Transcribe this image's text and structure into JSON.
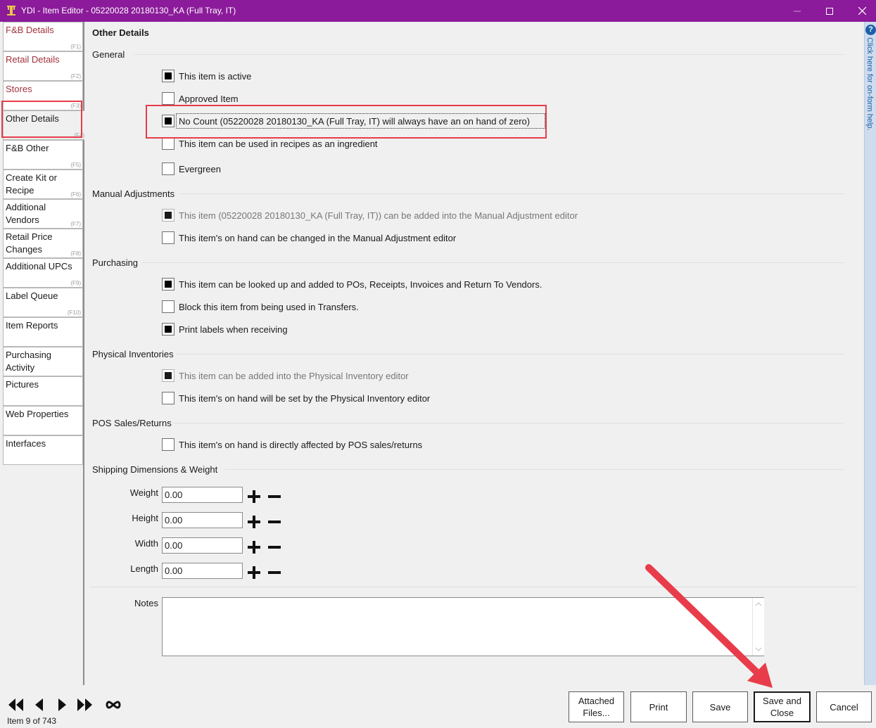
{
  "window": {
    "title": "YDI - Item Editor - 05220028 20180130_KA (Full Tray, IT)"
  },
  "nav": {
    "items": [
      {
        "label": "F&B Details",
        "key": "(F1)"
      },
      {
        "label": "Retail Details",
        "key": "(F2)"
      },
      {
        "label": "Stores",
        "key": "(F3)"
      },
      {
        "label": "Other Details",
        "key": "(F4)"
      },
      {
        "label": "F&B Other",
        "key": "(F5)"
      },
      {
        "label": "Create Kit or Recipe",
        "key": "(F6)"
      },
      {
        "label": "Additional Vendors",
        "key": "(F7)"
      },
      {
        "label": "Retail Price Changes",
        "key": "(F8)"
      },
      {
        "label": "Additional UPCs",
        "key": "(F9)"
      },
      {
        "label": "Label Queue",
        "key": "(F10)"
      },
      {
        "label": "Item Reports",
        "key": ""
      },
      {
        "label": "Purchasing Activity",
        "key": ""
      },
      {
        "label": "Pictures",
        "key": ""
      },
      {
        "label": "Web Properties",
        "key": ""
      },
      {
        "label": "Interfaces",
        "key": ""
      }
    ]
  },
  "main": {
    "title": "Other Details",
    "sections": {
      "general": "General",
      "manual": "Manual Adjustments",
      "purchasing": "Purchasing",
      "physical": "Physical Inventories",
      "pos": "POS Sales/Returns",
      "shipping": "Shipping Dimensions & Weight"
    },
    "checks": {
      "active": {
        "label": "This item is active",
        "checked": true
      },
      "approved": {
        "label": "Approved Item",
        "checked": false
      },
      "no_count": {
        "label": "No Count (05220028 20180130_KA (Full Tray, IT) will always have an on hand of zero)",
        "checked": true
      },
      "recipes": {
        "label": "This item can be used in recipes as an ingredient",
        "checked": false
      },
      "evergreen": {
        "label": "Evergreen",
        "checked": false
      },
      "manual_add": {
        "label": "This item (05220028 20180130_KA (Full Tray, IT)) can be added into the Manual Adjustment editor",
        "checked": true
      },
      "manual_change": {
        "label": "This item's on hand can be changed in the Manual Adjustment editor",
        "checked": false
      },
      "lookup_pos": {
        "label": "This item can be looked up and added to POs, Receipts, Invoices and Return To Vendors.",
        "checked": true
      },
      "block_transfers": {
        "label": "Block this item from being used in Transfers.",
        "checked": false
      },
      "print_labels": {
        "label": "Print labels when receiving",
        "checked": true
      },
      "physical_add": {
        "label": "This item can be added into the Physical Inventory editor",
        "checked": true
      },
      "physical_set": {
        "label": "This item's on hand will be set by the Physical Inventory editor",
        "checked": false
      },
      "pos_affected": {
        "label": "This item's on hand is directly affected by POS sales/returns",
        "checked": false
      }
    },
    "dimensions": {
      "weight_label": "Weight",
      "weight": "0.00",
      "height_label": "Height",
      "height": "0.00",
      "width_label": "Width",
      "width": "0.00",
      "length_label": "Length",
      "length": "0.00"
    },
    "notes_label": "Notes",
    "notes_value": ""
  },
  "help": {
    "text": "Click here for on-form help."
  },
  "footer": {
    "record": "Item 9 of 743",
    "buttons": {
      "attached": "Attached Files...",
      "print": "Print",
      "save": "Save",
      "save_close": "Save and Close",
      "cancel": "Cancel"
    }
  },
  "colors": {
    "titlebar": "#8b1b9a",
    "annotation": "#e83c4a",
    "nav_red_text": "#a1323c"
  }
}
